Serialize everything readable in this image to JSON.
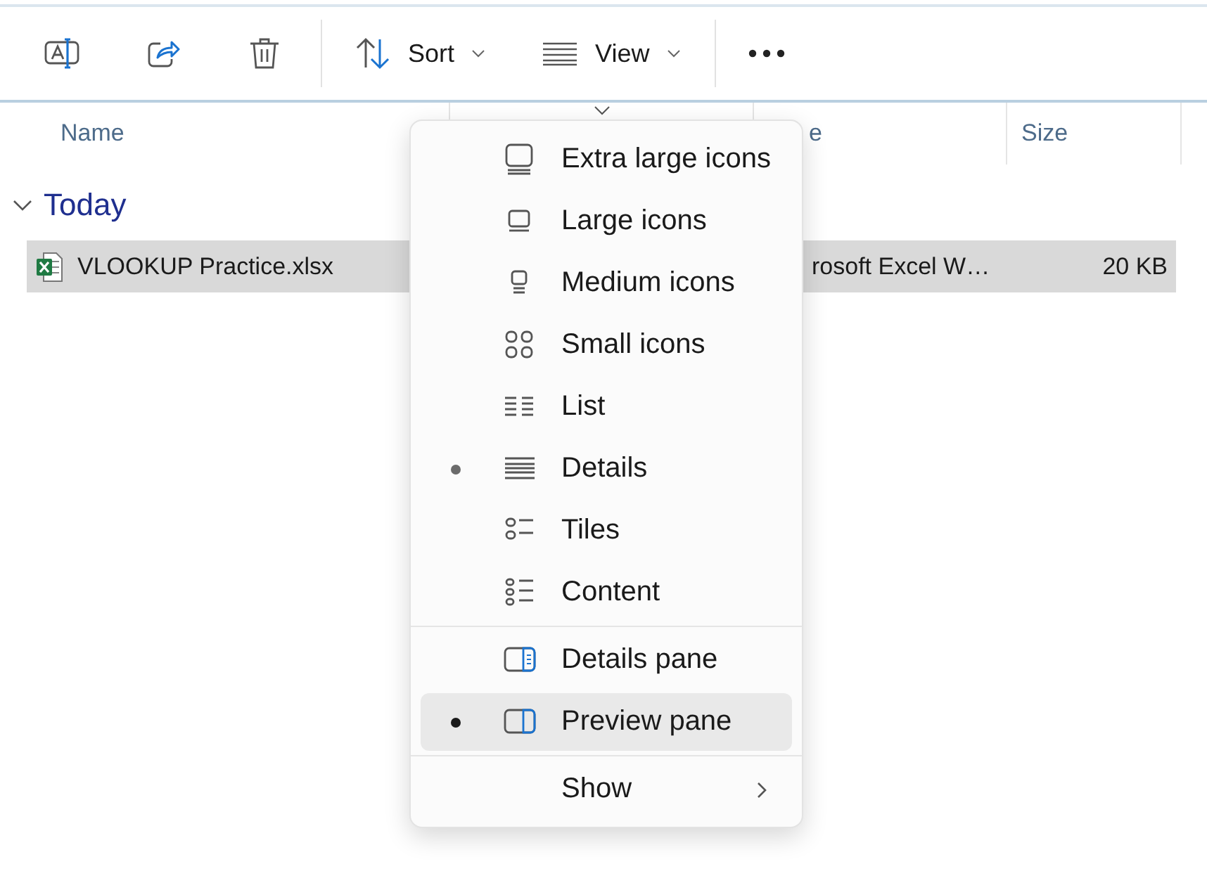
{
  "toolbar": {
    "sort_label": "Sort",
    "view_label": "View"
  },
  "columns": [
    {
      "label": "Name"
    },
    {
      "label": "e"
    },
    {
      "label": "Size"
    }
  ],
  "group": {
    "label": "Today",
    "expanded": true
  },
  "rows": [
    {
      "name": "VLOOKUP Practice.xlsx",
      "type": "rosoft Excel W…",
      "size": "20 KB",
      "selected": true
    }
  ],
  "view_menu": {
    "sections": [
      {
        "items": [
          {
            "kind": "option",
            "label": "Extra large icons",
            "selected": false,
            "highlighted": false
          },
          {
            "kind": "option",
            "label": "Large icons",
            "selected": false,
            "highlighted": false
          },
          {
            "kind": "option",
            "label": "Medium icons",
            "selected": false,
            "highlighted": false
          },
          {
            "kind": "option",
            "label": "Small icons",
            "selected": false,
            "highlighted": false
          },
          {
            "kind": "option",
            "label": "List",
            "selected": false,
            "highlighted": false
          },
          {
            "kind": "option",
            "label": "Details",
            "selected": true,
            "highlighted": false
          },
          {
            "kind": "option",
            "label": "Tiles",
            "selected": false,
            "highlighted": false
          },
          {
            "kind": "option",
            "label": "Content",
            "selected": false,
            "highlighted": false
          }
        ]
      },
      {
        "items": [
          {
            "kind": "option",
            "label": "Details pane",
            "selected": false,
            "highlighted": false
          },
          {
            "kind": "option",
            "label": "Preview pane",
            "selected": true,
            "highlighted": true
          }
        ]
      },
      {
        "items": [
          {
            "kind": "submenu",
            "label": "Show"
          }
        ]
      }
    ]
  }
}
